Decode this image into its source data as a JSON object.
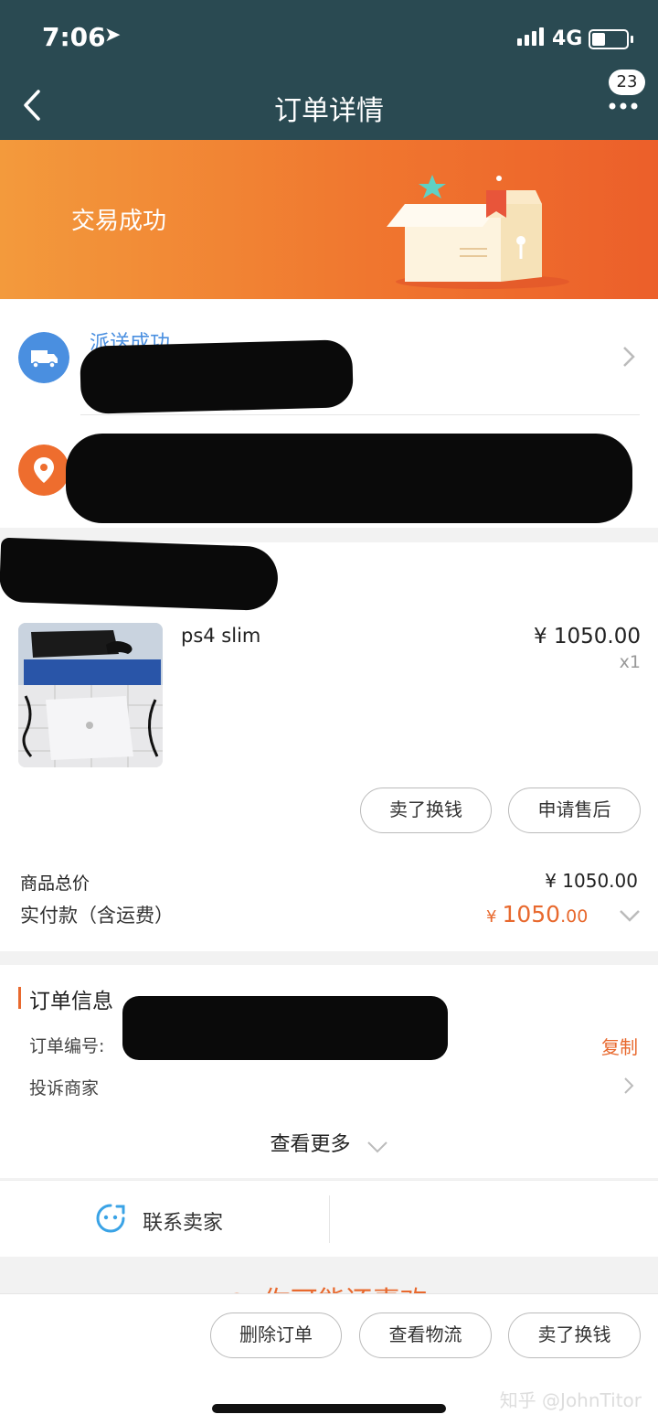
{
  "status_bar": {
    "time": "7:06",
    "network": "4G"
  },
  "nav": {
    "title": "订单详情",
    "badge_count": "23"
  },
  "banner": {
    "status": "交易成功"
  },
  "delivery": {
    "status": "派送成功"
  },
  "product": {
    "name": "ps4 slim",
    "price": "¥ 1050.00",
    "quantity": "x1",
    "buttons": {
      "sell": "卖了换钱",
      "after_sale": "申请售后"
    }
  },
  "totals": {
    "goods_total_label": "商品总价",
    "goods_total_value": "¥ 1050.00",
    "paid_label": "实付款（含运费）",
    "paid_currency": "¥",
    "paid_integer": "1050",
    "paid_decimal": ".00"
  },
  "order_info": {
    "heading": "订单信息",
    "order_no_label": "订单编号:",
    "copy_label": "复制",
    "complaint_label": "投诉商家",
    "see_more": "查看更多"
  },
  "contact": {
    "label": "联系卖家"
  },
  "bottom_bar": {
    "delete_label": "删除订单",
    "logistics_label": "查看物流",
    "sell_label": "卖了换钱"
  },
  "partial_text": "你可能还喜欢",
  "watermark": "知乎 @JohnTitor",
  "colors": {
    "header": "#2a4a52",
    "accent": "#e8692e",
    "banner_start": "#f39a3c",
    "banner_end": "#ec5f2a"
  }
}
